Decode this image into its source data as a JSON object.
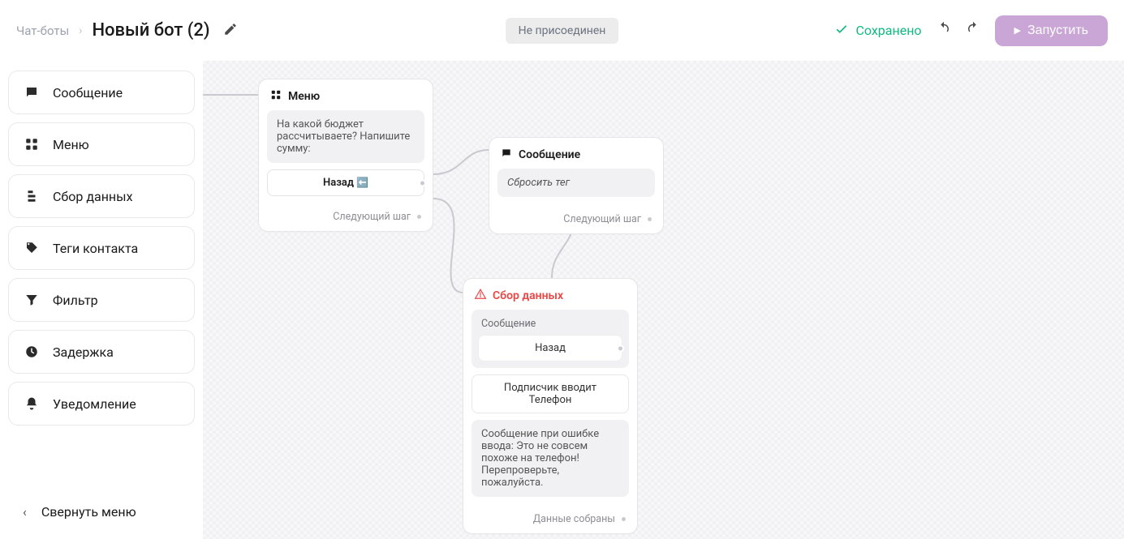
{
  "header": {
    "breadcrumb_root": "Чат-боты",
    "title": "Новый бот (2)",
    "connection_status": "Не присоединен",
    "saved_label": "Сохранено",
    "run_label": "Запустить"
  },
  "sidebar": {
    "items": [
      {
        "label": "Сообщение",
        "icon": "message-icon"
      },
      {
        "label": "Меню",
        "icon": "menu-grid-icon"
      },
      {
        "label": "Сбор данных",
        "icon": "form-icon"
      },
      {
        "label": "Теги контакта",
        "icon": "tag-icon"
      },
      {
        "label": "Фильтр",
        "icon": "filter-icon"
      },
      {
        "label": "Задержка",
        "icon": "clock-icon"
      },
      {
        "label": "Уведомление",
        "icon": "bell-icon"
      }
    ],
    "collapse_label": "Свернуть меню"
  },
  "nodes": {
    "menu": {
      "title": "Меню",
      "text": "На какой бюджет рассчитываете? Напишите сумму:",
      "button": "Назад",
      "footer": "Следующий шаг"
    },
    "message": {
      "title": "Сообщение",
      "text": "Сбросить тег",
      "footer": "Следующий шаг"
    },
    "collect": {
      "title": "Сбор данных",
      "section_label": "Сообщение",
      "button": "Назад",
      "input_label": "Подписчик вводит Телефон",
      "error_text": "Сообщение при ошибке ввода: Это не совсем похоже на телефон! Перепроверьте, пожалуйста.",
      "footer": "Данные собраны"
    }
  }
}
